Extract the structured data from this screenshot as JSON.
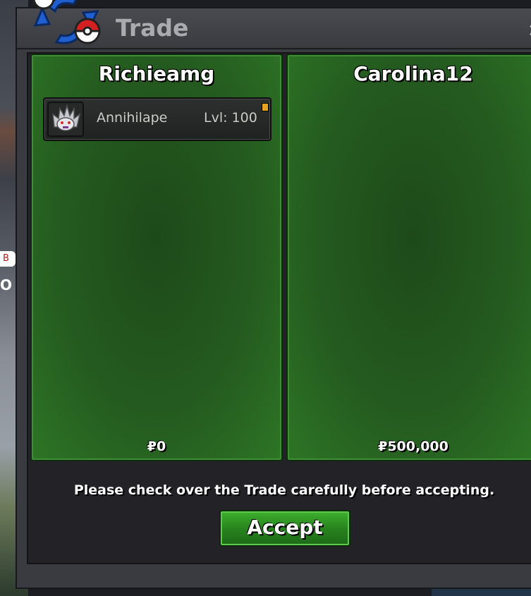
{
  "window": {
    "title": "Trade",
    "close_label": "×"
  },
  "left_panel": {
    "player": "Richieamg",
    "money": "₽0",
    "items": [
      {
        "name": "Annihilape",
        "level": "Lvl: 100"
      }
    ]
  },
  "right_panel": {
    "player": "Carolina12",
    "money": "₽500,000"
  },
  "notice": "Please check over the Trade carefully before accepting.",
  "accept_label": "Accept",
  "background": {
    "bubble": "B",
    "text": "O"
  },
  "colors": {
    "panel_green": "#245a1f",
    "button_green": "#2e9a22",
    "window_bg": "#3a3b40"
  }
}
